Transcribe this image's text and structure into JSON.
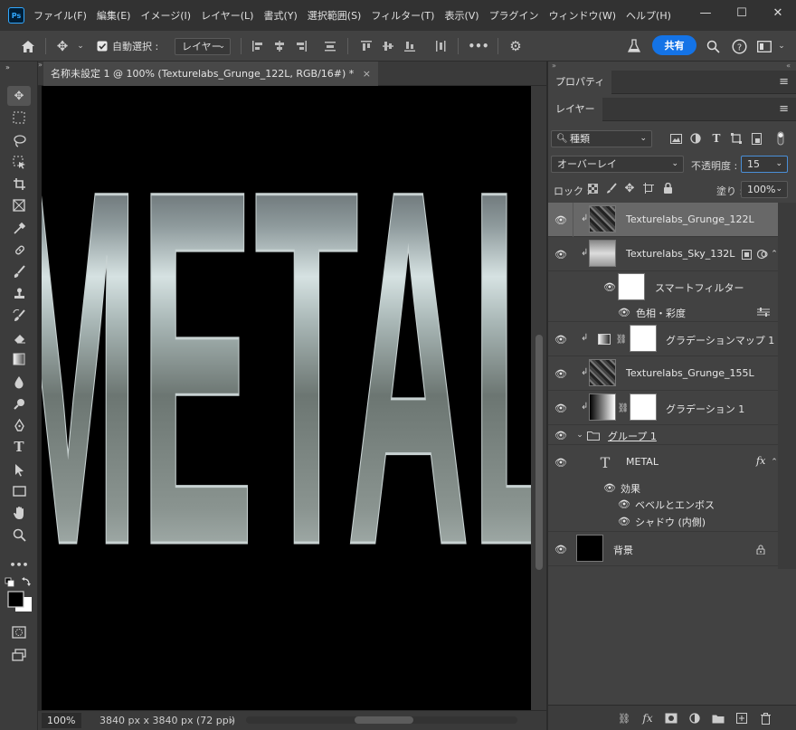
{
  "menu": {
    "app_icon": "Ps",
    "items": [
      "ファイル(F)",
      "編集(E)",
      "イメージ(I)",
      "レイヤー(L)",
      "書式(Y)",
      "選択範囲(S)",
      "フィルター(T)",
      "表示(V)",
      "プラグイン",
      "ウィンドウ(W)",
      "ヘルプ(H)"
    ],
    "window_controls": [
      "—",
      "☐",
      "✕"
    ]
  },
  "options": {
    "auto_select_label": "自動選択 :",
    "layer_select_value": "レイヤー",
    "more_label": "•••",
    "share_label": "共有"
  },
  "document": {
    "tab_title": "名称未設定 1 @ 100% (Texturelabs_Grunge_122L, RGB/16#) *",
    "tab_close": "×",
    "canvas_text": "METAL"
  },
  "status": {
    "zoom": "100%",
    "doc_size": "3840 px x 3840 px (72 ppi)",
    "arrow": "›"
  },
  "properties_panel": {
    "tab_label": "プロパティ"
  },
  "layers_panel": {
    "tab_label": "レイヤー",
    "filter_kind": "種類",
    "blend_mode": "オーバーレイ",
    "opacity_label": "不透明度 :",
    "opacity_value": "15",
    "lock_label": "ロック :",
    "fill_label": "塗り :",
    "fill_value": "100%",
    "layers": [
      {
        "name": "Texturelabs_Grunge_122L",
        "thumb": "grunge",
        "selected": true
      },
      {
        "name": "Texturelabs_Sky_132L",
        "thumb": "sky"
      },
      {
        "name": "スマートフィルター",
        "thumb": "white",
        "sub": true
      },
      {
        "name": "色相・彩度",
        "sub": true
      },
      {
        "name": "グラデーションマップ 1",
        "thumb": "gradmap"
      },
      {
        "name": "Texturelabs_Grunge_155L",
        "thumb": "grunge"
      },
      {
        "name": "グラデーション 1",
        "thumb": "grad"
      },
      {
        "name": "グループ 1",
        "group": true
      },
      {
        "name": "METAL",
        "type": "text",
        "fx": "fx"
      },
      {
        "name": "効果",
        "sub": true
      },
      {
        "name": "ベベルとエンボス",
        "sub": true
      },
      {
        "name": "シャドウ (内側)",
        "sub": true
      },
      {
        "name": "背景",
        "thumb": "black",
        "locked": true
      }
    ]
  },
  "colors": {
    "accent": "#1473e6",
    "panel_bg": "#424242",
    "toolbar_bg": "#3c3c3c",
    "selected_row": "#686868"
  }
}
